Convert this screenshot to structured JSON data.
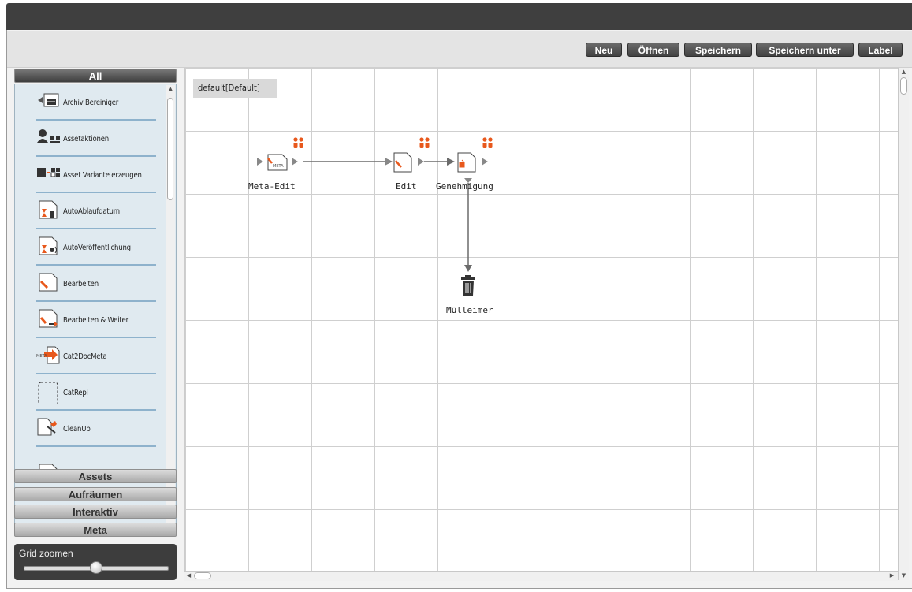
{
  "toolbar": {
    "buttons": [
      "Neu",
      "Öffnen",
      "Speichern",
      "Speichern unter",
      "Label"
    ]
  },
  "palette": {
    "active_category": "All",
    "items": [
      {
        "label": "Archiv Bereiniger",
        "icon": "archive-cleaner-icon"
      },
      {
        "label": "Assetaktionen",
        "icon": "asset-actions-icon"
      },
      {
        "label": "Asset Variante erzeugen",
        "icon": "asset-variant-icon"
      },
      {
        "label": "AutoAblaufdatum",
        "icon": "auto-expiry-icon"
      },
      {
        "label": "AutoVeröffentlichung",
        "icon": "auto-publish-icon"
      },
      {
        "label": "Bearbeiten",
        "icon": "edit-document-icon"
      },
      {
        "label": "Bearbeiten & Weiter",
        "icon": "edit-continue-icon"
      },
      {
        "label": "Cat2DocMeta",
        "icon": "meta-arrow-icon"
      },
      {
        "label": "CatRepl",
        "icon": "dashed-box-icon"
      },
      {
        "label": "CleanUp",
        "icon": "cleanup-icon"
      }
    ],
    "categories": [
      "Assets",
      "Aufräumen",
      "Interaktiv",
      "Meta"
    ]
  },
  "zoom": {
    "label": "Grid zoomen",
    "level": 0.5
  },
  "canvas": {
    "workflow_label": "default[Default]",
    "nodes": [
      {
        "label": "Meta-Edit",
        "icon": "meta-edit-icon",
        "badge": "users-icon"
      },
      {
        "label": "Edit",
        "icon": "edit-document-icon",
        "badge": "users-icon"
      },
      {
        "label": "Genehmigung",
        "icon": "approval-icon",
        "badge": "users-icon"
      },
      {
        "label": "Mülleimer",
        "icon": "trash-icon"
      }
    ]
  },
  "colors": {
    "accent_orange": "#e8581c",
    "item_divider": "#8eb2cc",
    "list_bg": "#e0eaf0",
    "dark_button": "#4a4a4a"
  }
}
